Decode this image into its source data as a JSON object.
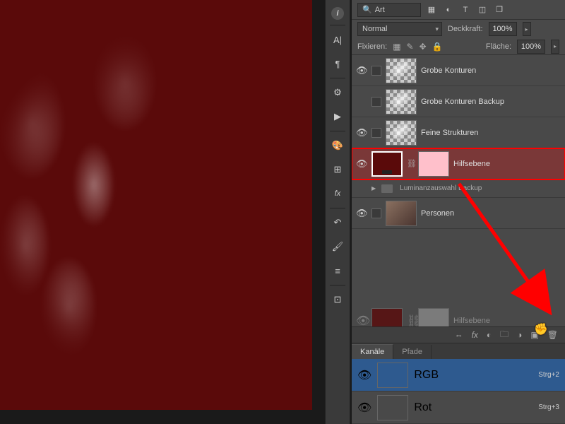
{
  "filter": {
    "placeholder": "Art"
  },
  "blend": {
    "mode": "Normal",
    "opacity_label": "Deckkraft:",
    "opacity": "100%",
    "fill_label": "Fläche:",
    "fill": "100%"
  },
  "lock": {
    "label": "Fixieren:"
  },
  "layers": [
    {
      "name": "Grobe Konturen",
      "visible": true,
      "type": "checker"
    },
    {
      "name": "Grobe Konturen Backup",
      "visible": false,
      "type": "checker"
    },
    {
      "name": "Feine Strukturen",
      "visible": true,
      "type": "checker"
    },
    {
      "name": "Hilfsebene",
      "visible": true,
      "type": "adjustment",
      "selected": true
    },
    {
      "name": "Luminanzauswahl Backup",
      "visible": false,
      "type": "group"
    },
    {
      "name": "Personen",
      "visible": true,
      "type": "photo"
    }
  ],
  "ghost": {
    "name": "Hilfsebene"
  },
  "tabs": {
    "channels": "Kanäle",
    "paths": "Pfade"
  },
  "channels": [
    {
      "name": "RGB",
      "shortcut": "Strg+2",
      "type": "red-ch",
      "selected": true
    },
    {
      "name": "Rot",
      "shortcut": "Strg+3",
      "type": "bw-ch",
      "selected": false
    }
  ]
}
